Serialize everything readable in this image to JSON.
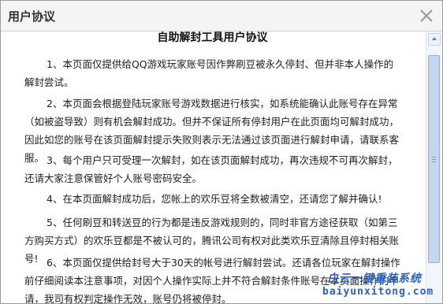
{
  "dialog": {
    "title": "用户协议"
  },
  "doc": {
    "title": "自助解封工具用户协议",
    "paragraphs": [
      "1、本页面仅提供给QQ游戏玩家账号因作弊刷豆被永久停封、但并非本人操作的解封尝试。",
      "2、本页面会根据登陆玩家账号游戏数据进行核实，如系统能确认此账号存在异常（如被盗导致）则有机会解封成功。但并不保证所有停封用户在此页面均可解封成功，因此如您的账号在该页面解封提示失败则表示无法通过该页面进行解封申请，请联系客服。",
      "3、每个用户只可受理一次解封，如在该页面解封成功，再次违规不可再次解封，还请大家注意保管好个人账号密码安全。",
      "4、在本页面解封成功后，您帐上的欢乐豆将全数被清空，还请您了解并确认!",
      "5、任何刷豆和转送豆的行为都是违反游戏规则的，同时非官方途径获取（如第三方购买方式）的欢乐豆都是不被认可的，腾讯公司有权对此类欢乐豆清除且停封相关账号!",
      "6、本页面仅提供给封号大于30天的帐号进行解封尝试。还请各位玩家在解封操作前仔细阅读本注意事项，对因个人操作实际上并不符合解封条件账号在本页面操作的申请，我司有权判定操作无效，账号仍将被停封。"
    ]
  },
  "watermark": {
    "text": "白云一键重装系统",
    "url": "baiyunxitong.com"
  },
  "icons": {
    "close": "close-icon",
    "scroll_up": "scroll-up-arrow-icon"
  }
}
